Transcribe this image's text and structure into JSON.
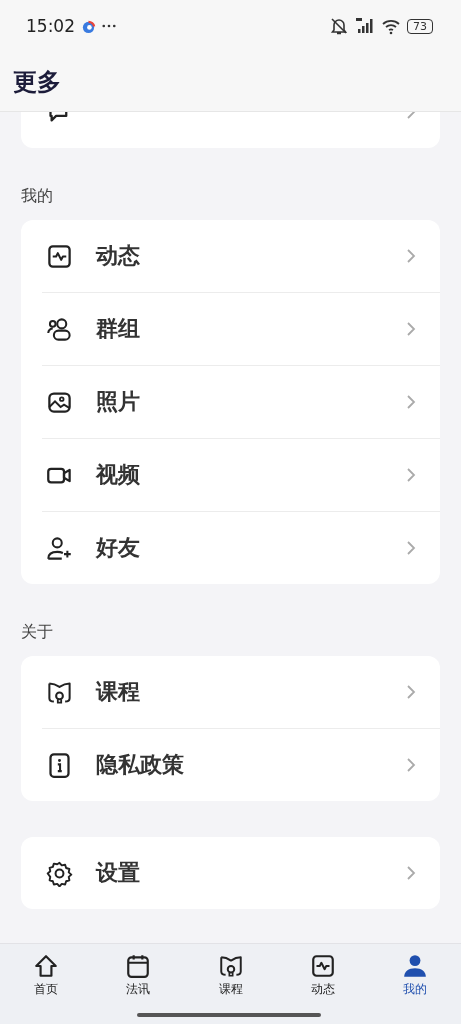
{
  "status_bar": {
    "time": "15:02",
    "battery": "73"
  },
  "header": {
    "title": "更多"
  },
  "sections": [
    {
      "items": [
        {
          "kind": "chat"
        }
      ]
    },
    {
      "title": "我的",
      "items": [
        {
          "label": "动态",
          "kind": "pulse"
        },
        {
          "label": "群组",
          "kind": "group"
        },
        {
          "label": "照片",
          "kind": "photo"
        },
        {
          "label": "视频",
          "kind": "video"
        },
        {
          "label": "好友",
          "kind": "add-user"
        }
      ]
    },
    {
      "title": "关于",
      "items": [
        {
          "label": "课程",
          "kind": "course"
        },
        {
          "label": "隐私政策",
          "kind": "info"
        }
      ]
    },
    {
      "items": [
        {
          "label": "设置",
          "kind": "settings"
        }
      ]
    }
  ],
  "tab_bar": [
    {
      "label": "首页",
      "kind": "home",
      "selected": false
    },
    {
      "label": "法讯",
      "kind": "calendar",
      "selected": false
    },
    {
      "label": "课程",
      "kind": "course",
      "selected": false
    },
    {
      "label": "动态",
      "kind": "pulse",
      "selected": false
    },
    {
      "label": "我的",
      "kind": "person",
      "selected": true
    }
  ]
}
